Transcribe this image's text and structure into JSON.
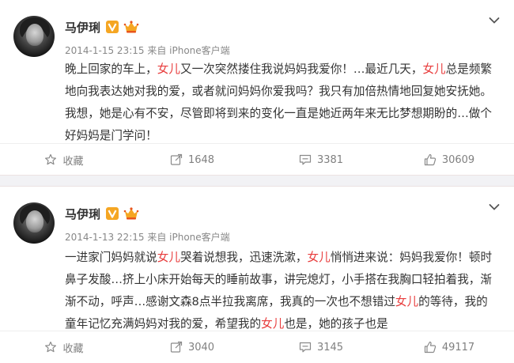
{
  "colors": {
    "highlight": "#e83c3c",
    "verified_badge": "#f5a623",
    "separator": "#f2f2f5",
    "meta_text": "#888888"
  },
  "posts": [
    {
      "username": "马伊琍",
      "verified_icon": "verified-v-icon",
      "member_icon": "crown-member-icon",
      "timestamp": "2014-1-15 23:15",
      "source": "来自 iPhone客户端",
      "content": [
        {
          "text": "晚上回家的车上，"
        },
        {
          "text": "女儿",
          "hl": true
        },
        {
          "text": "又一次突然搂住我说妈妈我爱你！…最近几天，"
        },
        {
          "text": "女儿",
          "hl": true
        },
        {
          "text": "总是频繁地向我表达她对我的爱，或者就问妈妈你爱我吗？我只有加倍热情地回复她安抚她。我想，她是心有不安，尽管即将到来的变化一直是她近两年来无比梦想期盼的…做个好妈妈是门学问！"
        }
      ],
      "actions": {
        "favorite": "收藏",
        "repost": "1648",
        "comment": "3381",
        "like": "30609"
      }
    },
    {
      "username": "马伊琍",
      "verified_icon": "verified-v-icon",
      "member_icon": "crown-member-icon",
      "timestamp": "2014-1-13 22:15",
      "source": "来自 iPhone客户端",
      "content": [
        {
          "text": "一进家门妈妈就说"
        },
        {
          "text": "女儿",
          "hl": true
        },
        {
          "text": "哭着说想我，迅速洗漱，"
        },
        {
          "text": "女儿",
          "hl": true
        },
        {
          "text": "悄悄进来说：妈妈我爱你！顿时鼻子发酸…挤上小床开始每天的睡前故事，讲完熄灯，小手搭在我胸口轻拍着我，渐渐不动，呼声…感谢文森8点半拉我离席，我真的一次也不想错过"
        },
        {
          "text": "女儿",
          "hl": true
        },
        {
          "text": "的等待，我的童年记忆充满妈妈对我的爱，希望我的"
        },
        {
          "text": "女儿",
          "hl": true
        },
        {
          "text": "也是，她的孩子也是"
        }
      ],
      "actions": {
        "favorite": "收藏",
        "repost": "3040",
        "comment": "3145",
        "like": "49117"
      }
    }
  ]
}
